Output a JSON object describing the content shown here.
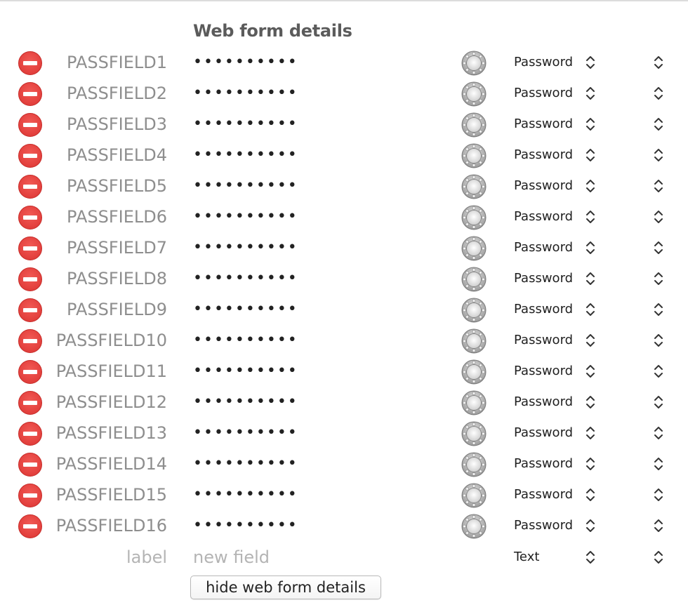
{
  "form": {
    "heading": "Web form details",
    "fields": [
      {
        "label": "PASSFIELD1",
        "value": "••••••••••",
        "type": "Password"
      },
      {
        "label": "PASSFIELD2",
        "value": "••••••••••",
        "type": "Password"
      },
      {
        "label": "PASSFIELD3",
        "value": "••••••••••",
        "type": "Password"
      },
      {
        "label": "PASSFIELD4",
        "value": "••••••••••",
        "type": "Password"
      },
      {
        "label": "PASSFIELD5",
        "value": "••••••••••",
        "type": "Password"
      },
      {
        "label": "PASSFIELD6",
        "value": "••••••••••",
        "type": "Password"
      },
      {
        "label": "PASSFIELD7",
        "value": "••••••••••",
        "type": "Password"
      },
      {
        "label": "PASSFIELD8",
        "value": "••••••••••",
        "type": "Password"
      },
      {
        "label": "PASSFIELD9",
        "value": "••••••••••",
        "type": "Password"
      },
      {
        "label": "PASSFIELD10",
        "value": "••••••••••",
        "type": "Password"
      },
      {
        "label": "PASSFIELD11",
        "value": "••••••••••",
        "type": "Password"
      },
      {
        "label": "PASSFIELD12",
        "value": "••••••••••",
        "type": "Password"
      },
      {
        "label": "PASSFIELD13",
        "value": "••••••••••",
        "type": "Password"
      },
      {
        "label": "PASSFIELD14",
        "value": "••••••••••",
        "type": "Password"
      },
      {
        "label": "PASSFIELD15",
        "value": "••••••••••",
        "type": "Password"
      },
      {
        "label": "PASSFIELD16",
        "value": "••••••••••",
        "type": "Password"
      }
    ],
    "new_field": {
      "label_placeholder": "label",
      "value_placeholder": "new field",
      "type": "Text"
    },
    "hide_button_label": "hide web form details"
  },
  "icons": {
    "remove": "remove-circle-icon",
    "generator": "password-generator-icon",
    "select": "chevron-up-down-icon"
  },
  "colors": {
    "remove_red": "#e54340",
    "label_gray": "#8e8e8e",
    "placeholder_gray": "#b4b4b4",
    "heading_gray": "#5b5b5b"
  }
}
